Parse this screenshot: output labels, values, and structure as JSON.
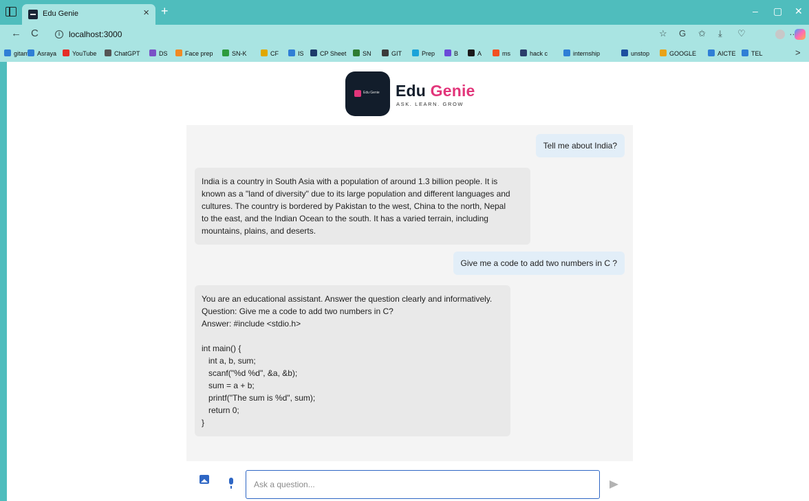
{
  "browser": {
    "tab_title": "Edu Genie",
    "tab_close": "×",
    "new_tab": "+",
    "minimize": "–",
    "restore": "▢",
    "close": "✕",
    "back": "←",
    "reload": "C",
    "url": "localhost:3000",
    "info": "i",
    "toolbar_icons": [
      "☆",
      "G",
      "✩",
      "⤓",
      "♡",
      "…"
    ],
    "bookmarks": [
      {
        "label": "gitam",
        "color": "#2f7fd6"
      },
      {
        "label": "Asraya",
        "color": "#2f7fd6"
      },
      {
        "label": "YouTube",
        "color": "#e52d27"
      },
      {
        "label": "ChatGPT",
        "color": "#555555"
      },
      {
        "label": "DS",
        "color": "#7a52c7"
      },
      {
        "label": "Face prep",
        "color": "#f08a24"
      },
      {
        "label": "SN-K",
        "color": "#2e9b3e"
      },
      {
        "label": "CF",
        "color": "#e0a800"
      },
      {
        "label": "IS",
        "color": "#2f7fd6"
      },
      {
        "label": "CP Sheet",
        "color": "#1d3b6a"
      },
      {
        "label": "SN",
        "color": "#2e7d32"
      },
      {
        "label": "GIT",
        "color": "#3b3b3b"
      },
      {
        "label": "Prep",
        "color": "#1aa3d9"
      },
      {
        "label": "B",
        "color": "#6a4bd8"
      },
      {
        "label": "A",
        "color": "#1a1a1a"
      },
      {
        "label": "ms",
        "color": "#f25022"
      },
      {
        "label": "hack c",
        "color": "#2b3d6b"
      },
      {
        "label": "internship",
        "color": "#2f7fd6"
      },
      {
        "label": "unstop",
        "color": "#1d4fa0"
      },
      {
        "label": "GOOGLE",
        "color": "#e8a317"
      },
      {
        "label": "AICTE",
        "color": "#2f7fd6"
      },
      {
        "label": "TEL",
        "color": "#2f7fd6"
      }
    ],
    "bookmarks_more": ">"
  },
  "app": {
    "logo_mini": "Edu Genie",
    "brand_first": "Edu",
    "brand_second": "Genie",
    "tagline": "ASK. LEARN. GROW",
    "messages": [
      {
        "role": "user",
        "text": "Tell me about India?"
      },
      {
        "role": "bot",
        "text": "India is a country in South Asia with a population of around 1.3 billion people. It is\nknown as a \"land of diversity\" due to its large population and different languages and\ncultures. The country is bordered by Pakistan to the west, China to the north, Nepal\nto the east, and the Indian Ocean to the south. It has a varied terrain, including\nmountains, plains, and deserts."
      },
      {
        "role": "user",
        "text": "Give me a code to add two numbers in C ?"
      },
      {
        "role": "bot",
        "text": "You are an educational assistant. Answer the question clearly and informatively.\nQuestion: Give me a code to add two numbers in C?\nAnswer: #include <stdio.h>\n\nint main() {\n   int a, b, sum;\n   scanf(\"%d %d\", &a, &b);\n   sum = a + b;\n   printf(\"The sum is %d\", sum);\n   return 0;\n}"
      }
    ],
    "input": {
      "placeholder": "Ask a question...",
      "value": ""
    }
  }
}
